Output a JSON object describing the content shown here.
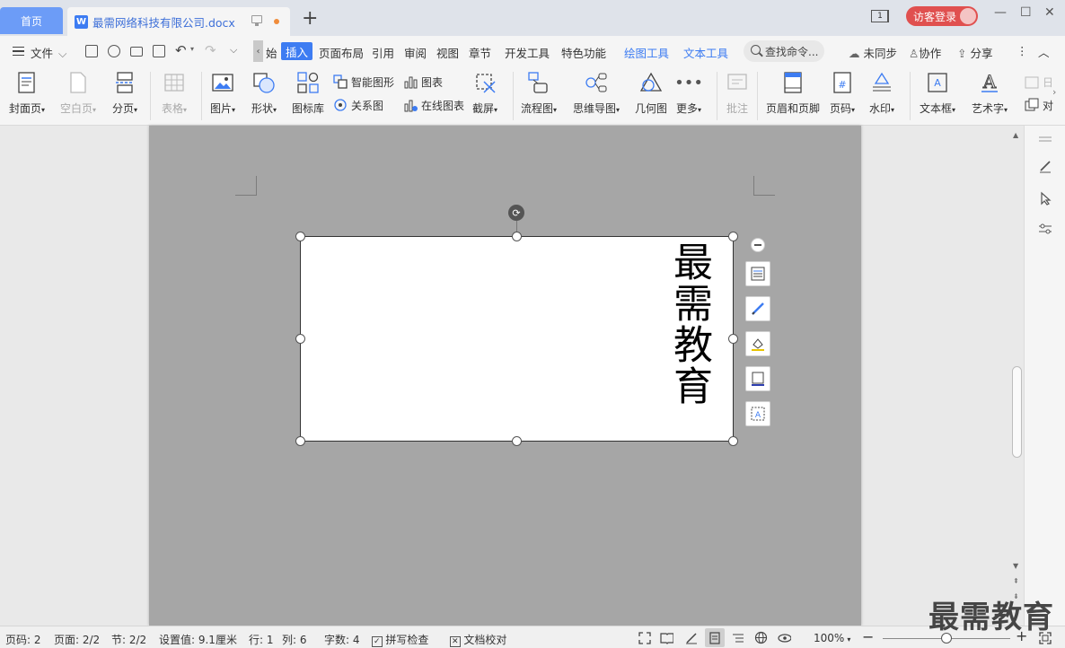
{
  "titlebar": {
    "home_tab": "首页",
    "doc_icon_letter": "W",
    "doc_title": "最需网络科技有限公司.docx",
    "new_tab": "+",
    "window_badge": "1",
    "login_label": "访客登录",
    "minimize": "—",
    "maximize": "☐",
    "close": "✕"
  },
  "menubar": {
    "file_label": "文件",
    "scroll_left": "‹",
    "tabs": [
      "始",
      "插入",
      "页面布局",
      "引用",
      "审阅",
      "视图",
      "章节",
      "开发工具",
      "特色功能",
      "绘图工具",
      "文本工具"
    ],
    "active_tab": "插入",
    "search_label": "查找命令...",
    "sync_label": "未同步",
    "collab_label": "协作",
    "share_label": "分享",
    "more": "⋮",
    "collapse": "︿"
  },
  "ribbon": {
    "cover_page": "封面页",
    "blank_page": "空白页",
    "page_break": "分页",
    "table": "表格",
    "picture": "图片",
    "shape": "形状",
    "icon_lib": "图标库",
    "smart_art": "智能图形",
    "chart": "图表",
    "relation": "关系图",
    "online_chart": "在线图表",
    "screenshot": "截屏",
    "flowchart": "流程图",
    "mindmap": "思维导图",
    "geometry": "几何图",
    "more": "更多",
    "comment": "批注",
    "header_footer": "页眉和页脚",
    "page_number": "页码",
    "watermark": "水印",
    "textbox": "文本框",
    "wordart": "艺术字",
    "date_partial": "日",
    "object_partial": "对",
    "dropdown_mark": "▾"
  },
  "document": {
    "textbox_text": "最需教育",
    "rotate_symbol": "⟳"
  },
  "statusbar": {
    "page_code": "页码: 2",
    "pages": "页面: 2/2",
    "section": "节: 2/2",
    "setting_value": "设置值: 9.1厘米",
    "row": "行: 1",
    "column": "列: 6",
    "word_count": "字数: 4",
    "spell_check": "拼写检查",
    "doc_proof": "文档校对",
    "zoom": "100%",
    "zoom_minus": "−",
    "zoom_plus": "+",
    "zoom_level": 0.5
  },
  "watermark": "最需教育",
  "colors": {
    "accent": "#3d7cf2",
    "home_tab": "#6c9cf7",
    "login": "#e0504f",
    "page_area": "#a6a6a6"
  }
}
